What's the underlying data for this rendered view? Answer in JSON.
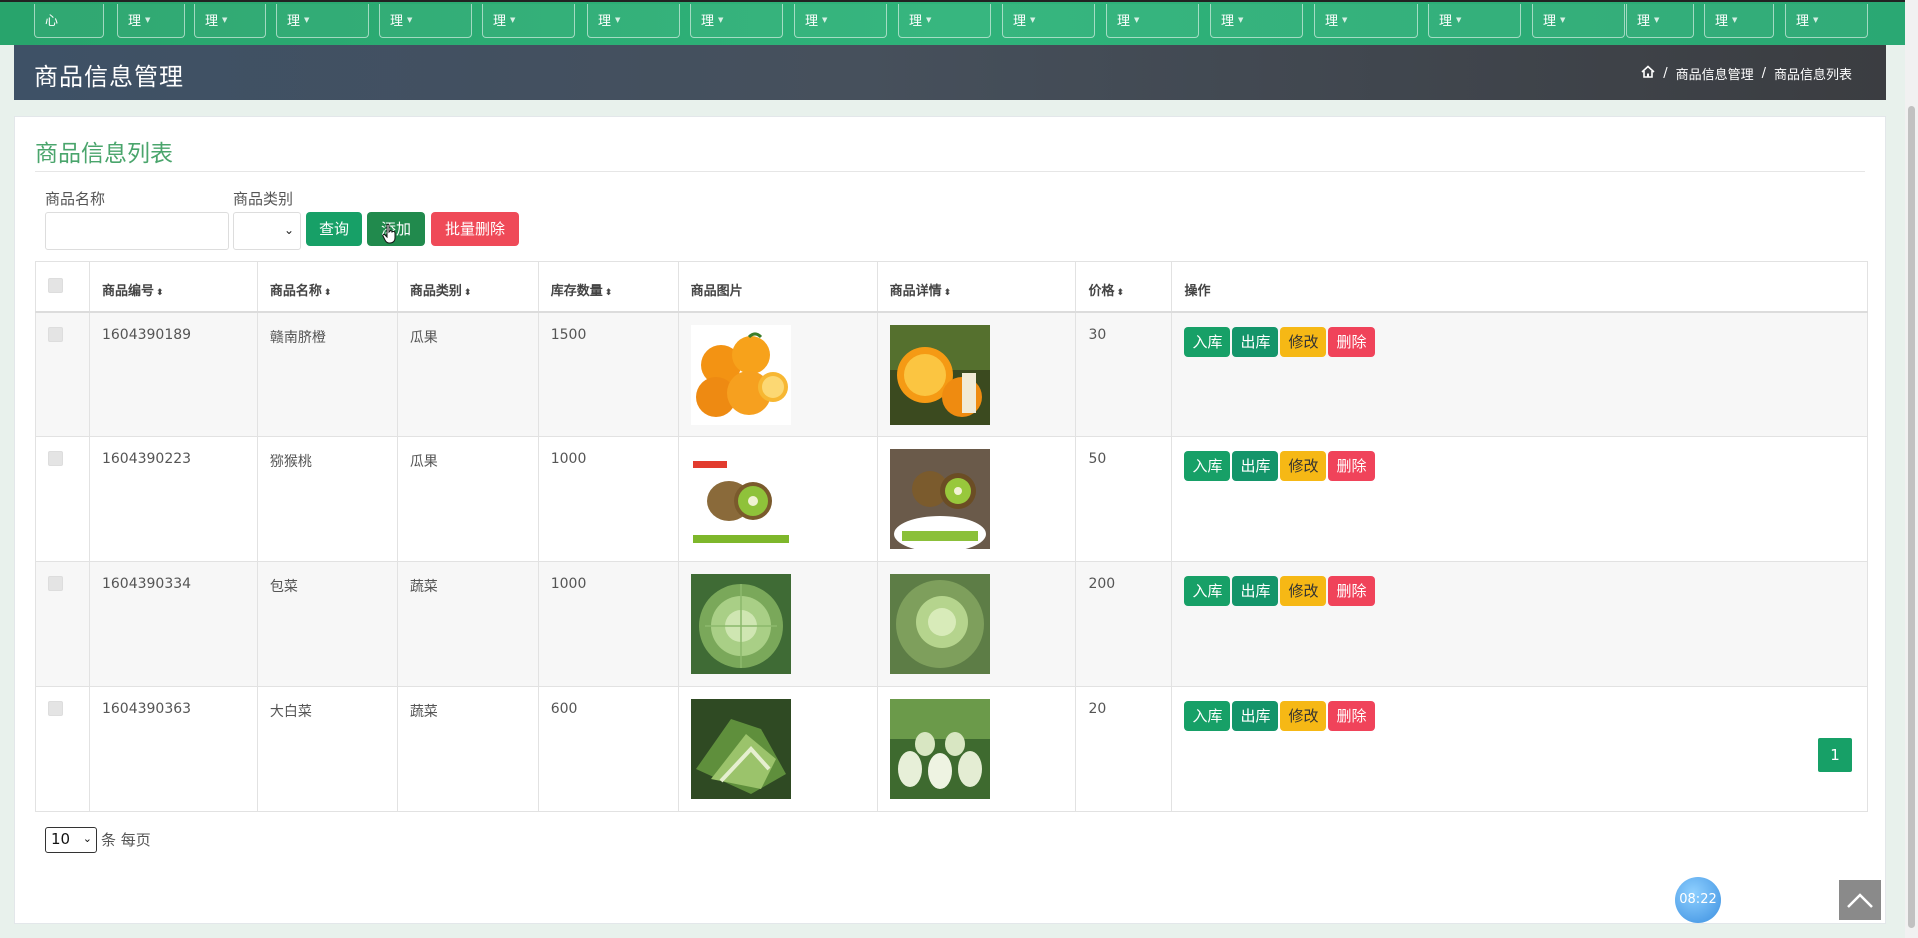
{
  "nav": {
    "tabs": [
      "心",
      "理",
      "理",
      "理",
      "理",
      "理",
      "理",
      "理",
      "理",
      "理",
      "理",
      "理",
      "理",
      "理",
      "理",
      "理",
      "理",
      "理",
      "理"
    ]
  },
  "header": {
    "title": "商品信息管理",
    "breadcrumb": [
      "商品信息管理",
      "商品信息列表"
    ]
  },
  "panel": {
    "title": "商品信息列表"
  },
  "filters": {
    "name_label": "商品名称",
    "name_value": "",
    "category_label": "商品类别",
    "category_value": "",
    "query_label": "查询",
    "add_label": "添加",
    "bulk_delete_label": "批量删除"
  },
  "table": {
    "columns": [
      "商品编号",
      "商品名称",
      "商品类别",
      "库存数量",
      "商品图片",
      "商品详情",
      "价格",
      "操作"
    ],
    "actions": {
      "stock_in": "入库",
      "stock_out": "出库",
      "edit": "修改",
      "delete": "删除"
    },
    "rows": [
      {
        "id": "1604390189",
        "name": "赣南脐橙",
        "category": "瓜果",
        "stock": "1500",
        "price": "30",
        "image": "oranges-photo",
        "detail_image": "orange-halves-photo"
      },
      {
        "id": "1604390223",
        "name": "猕猴桃",
        "category": "瓜果",
        "stock": "1000",
        "price": "50",
        "image": "kiwi-promo-photo",
        "detail_image": "kiwi-promo-photo-2"
      },
      {
        "id": "1604390334",
        "name": "包菜",
        "category": "蔬菜",
        "stock": "1000",
        "price": "200",
        "image": "cabbage-photo",
        "detail_image": "cabbage-field-photo"
      },
      {
        "id": "1604390363",
        "name": "大白菜",
        "category": "蔬菜",
        "stock": "600",
        "price": "20",
        "image": "napa-cabbage-photo",
        "detail_image": "napa-cabbage-field-photo"
      }
    ]
  },
  "pager": {
    "page_size": "10",
    "page_size_suffix": "条 每页",
    "current_page": "1"
  },
  "widgets": {
    "clock": "08:22"
  },
  "colors": {
    "accent": "#17a067",
    "warning": "#f6b815",
    "danger": "#f0435a",
    "panel_title": "#4aa56c"
  }
}
